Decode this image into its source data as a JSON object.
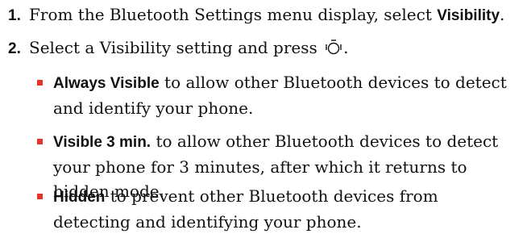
{
  "steps": [
    {
      "number": "1.",
      "text_before": "From the Bluetooth Settings menu display, select ",
      "bold": "Visibility",
      "text_after": "."
    },
    {
      "number": "2.",
      "text_before": "Select a Visibility setting and press ",
      "icon": "ok-key-icon",
      "text_after": "."
    }
  ],
  "bullets": [
    {
      "bold": "Always Visible",
      "text": " to allow other Bluetooth devices to detect and identify your phone."
    },
    {
      "bold": "Visible 3 min.",
      "text": " to allow other Bluetooth devices to detect your phone for 3 minutes, after which it returns to hidden mode."
    },
    {
      "bold": "Hidden",
      "text": " to prevent other Bluetooth devices from detecting and identifying your phone."
    }
  ],
  "colors": {
    "bullet": "#e8332a",
    "text": "#111111"
  }
}
